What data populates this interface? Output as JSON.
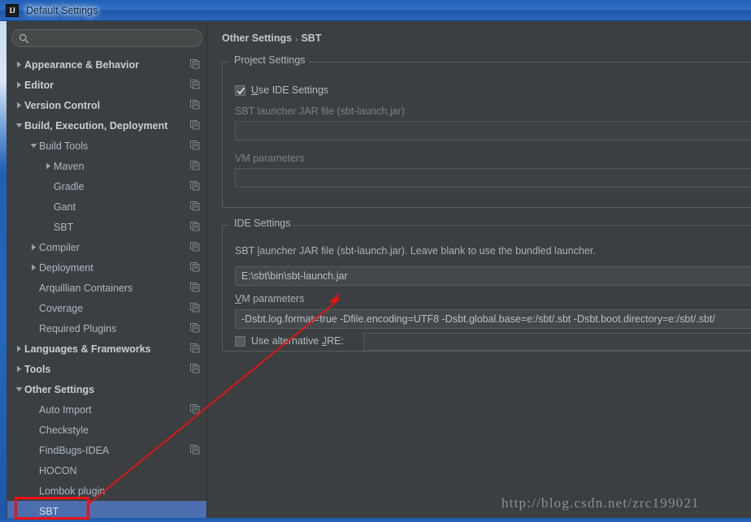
{
  "window": {
    "title": "Default Settings",
    "icon": "intellij-idea-logo-icon",
    "app_initials": "IJ"
  },
  "sidebar": {
    "search": {
      "value": "",
      "placeholder": "",
      "icon": "search-icon"
    },
    "items": [
      {
        "label": "Appearance & Behavior",
        "indent": 0,
        "twisty": "collapsed",
        "bold": true,
        "copy": true,
        "selected": false
      },
      {
        "label": "Editor",
        "indent": 0,
        "twisty": "collapsed",
        "bold": true,
        "copy": true,
        "selected": false
      },
      {
        "label": "Version Control",
        "indent": 0,
        "twisty": "collapsed",
        "bold": true,
        "copy": true,
        "selected": false
      },
      {
        "label": "Build, Execution, Deployment",
        "indent": 0,
        "twisty": "expanded",
        "bold": true,
        "copy": true,
        "selected": false
      },
      {
        "label": "Build Tools",
        "indent": 1,
        "twisty": "expanded",
        "bold": false,
        "copy": true,
        "selected": false
      },
      {
        "label": "Maven",
        "indent": 2,
        "twisty": "collapsed",
        "bold": false,
        "copy": true,
        "selected": false
      },
      {
        "label": "Gradle",
        "indent": 2,
        "twisty": "none",
        "bold": false,
        "copy": true,
        "selected": false
      },
      {
        "label": "Gant",
        "indent": 2,
        "twisty": "none",
        "bold": false,
        "copy": true,
        "selected": false
      },
      {
        "label": "SBT",
        "indent": 2,
        "twisty": "none",
        "bold": false,
        "copy": true,
        "selected": false
      },
      {
        "label": "Compiler",
        "indent": 1,
        "twisty": "collapsed",
        "bold": false,
        "copy": true,
        "selected": false
      },
      {
        "label": "Deployment",
        "indent": 1,
        "twisty": "collapsed",
        "bold": false,
        "copy": true,
        "selected": false
      },
      {
        "label": "Arquillian Containers",
        "indent": 1,
        "twisty": "none",
        "bold": false,
        "copy": true,
        "selected": false
      },
      {
        "label": "Coverage",
        "indent": 1,
        "twisty": "none",
        "bold": false,
        "copy": true,
        "selected": false
      },
      {
        "label": "Required Plugins",
        "indent": 1,
        "twisty": "none",
        "bold": false,
        "copy": true,
        "selected": false
      },
      {
        "label": "Languages & Frameworks",
        "indent": 0,
        "twisty": "collapsed",
        "bold": true,
        "copy": true,
        "selected": false
      },
      {
        "label": "Tools",
        "indent": 0,
        "twisty": "collapsed",
        "bold": true,
        "copy": true,
        "selected": false
      },
      {
        "label": "Other Settings",
        "indent": 0,
        "twisty": "expanded",
        "bold": true,
        "copy": false,
        "selected": false
      },
      {
        "label": "Auto Import",
        "indent": 1,
        "twisty": "none",
        "bold": false,
        "copy": true,
        "selected": false
      },
      {
        "label": "Checkstyle",
        "indent": 1,
        "twisty": "none",
        "bold": false,
        "copy": false,
        "selected": false
      },
      {
        "label": "FindBugs-IDEA",
        "indent": 1,
        "twisty": "none",
        "bold": false,
        "copy": true,
        "selected": false
      },
      {
        "label": "HOCON",
        "indent": 1,
        "twisty": "none",
        "bold": false,
        "copy": false,
        "selected": false
      },
      {
        "label": "Lombok plugin",
        "indent": 1,
        "twisty": "none",
        "bold": false,
        "copy": false,
        "selected": false
      },
      {
        "label": "SBT",
        "indent": 1,
        "twisty": "none",
        "bold": false,
        "copy": false,
        "selected": true
      }
    ]
  },
  "breadcrumb": {
    "parent": "Other Settings",
    "separator": "›",
    "current": "SBT"
  },
  "project_settings": {
    "group_title": "Project Settings",
    "use_ide_settings": {
      "label": "Use IDE Settings",
      "checked": true
    },
    "launcher_jar": {
      "label": "SBT launcher JAR file (sbt-launch.jar)",
      "value": "",
      "disabled": true
    },
    "vm_parameters": {
      "label": "VM parameters",
      "value": "",
      "disabled": true
    }
  },
  "ide_settings": {
    "group_title": "IDE Settings",
    "launcher_jar": {
      "label": "SBT launcher JAR file (sbt-launch.jar). Leave blank to use the bundled launcher.",
      "value": "E:\\sbt\\bin\\sbt-launch.jar"
    },
    "vm_parameters": {
      "label": "VM parameters",
      "value": "-Dsbt.log.format=true -Dfile.encoding=UTF8  -Dsbt.global.base=e:/sbt/.sbt -Dsbt.boot.directory=e:/sbt/.sbt/"
    },
    "alternative_jre": {
      "label": "Use alternative JRE:",
      "checked": false,
      "value": ""
    }
  },
  "annotations": {
    "watermark": "http://blog.csdn.net/zrc199021",
    "highlight_color": "#ee1111"
  },
  "colors": {
    "panel_bg": "#3c3f41",
    "selection": "#4b6eaf",
    "text": "#a9b7c6",
    "title_bar": "#2468c0"
  }
}
